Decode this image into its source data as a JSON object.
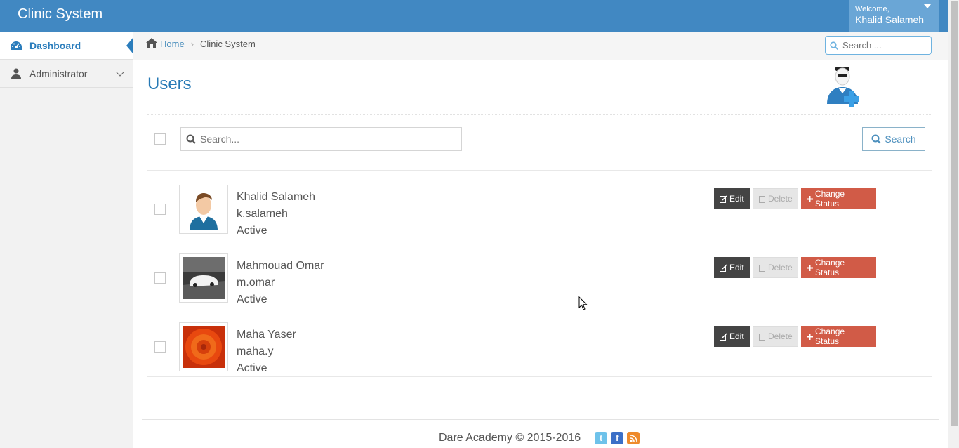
{
  "app": {
    "brand": "Clinic System"
  },
  "user_menu": {
    "welcome": "Welcome,",
    "name": "Khalid Salameh"
  },
  "sidebar": {
    "items": [
      {
        "label": "Dashboard",
        "icon": "dashboard-icon",
        "active": true
      },
      {
        "label": "Administrator",
        "icon": "user-icon",
        "active": false
      }
    ]
  },
  "breadcrumb": {
    "home": "Home",
    "current": "Clinic System"
  },
  "top_search": {
    "placeholder": "Search ..."
  },
  "page": {
    "title": "Users"
  },
  "filter": {
    "placeholder": "Search...",
    "button_label": "Search"
  },
  "users": [
    {
      "name": "Khalid Salameh",
      "username": "k.salameh",
      "status": "Active",
      "avatar": "default-man-avatar"
    },
    {
      "name": "Mahmouad Omar",
      "username": "m.omar",
      "status": "Active",
      "avatar": "car-photo"
    },
    {
      "name": "Maha Yaser",
      "username": "maha.y",
      "status": "Active",
      "avatar": "flower-photo"
    }
  ],
  "row_actions": {
    "edit": "Edit",
    "delete": "Delete",
    "change_status": "Change Status"
  },
  "footer": {
    "text": "Dare Academy © 2015-2016"
  },
  "colors": {
    "navbar": "#4188c2",
    "accent": "#2679b5",
    "danger": "#d15b47",
    "dark": "#444444"
  }
}
